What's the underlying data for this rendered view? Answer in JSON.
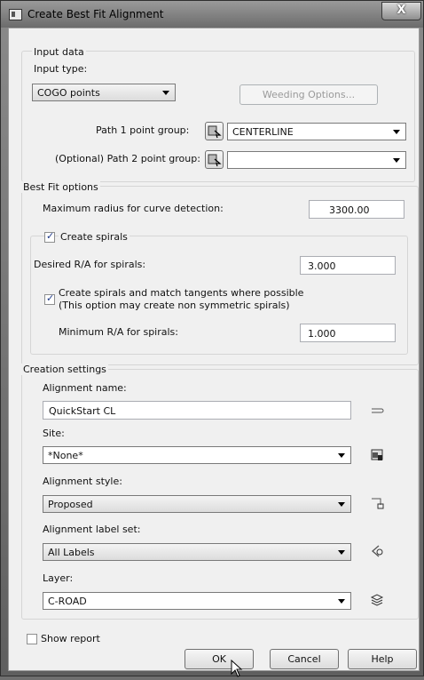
{
  "window": {
    "title": "Create Best Fit Alignment",
    "close": "X"
  },
  "input_data": {
    "group_label": "Input data",
    "input_type_label": "Input type:",
    "input_type_value": "COGO points",
    "weeding_button": "Weeding Options...",
    "path1_label": "Path 1 point group:",
    "path1_value": "CENTERLINE",
    "path2_label": "(Optional) Path 2 point group:",
    "path2_value": ""
  },
  "best_fit": {
    "group_label": "Best Fit options",
    "max_radius_label": "Maximum radius for curve detection:",
    "max_radius_value": "3300.00",
    "create_spirals_label": "Create spirals",
    "create_spirals_checked": true,
    "desired_ra_label": "Desired R/A for spirals:",
    "desired_ra_value": "3.000",
    "match_tangents_label_1": "Create spirals and match tangents where possible",
    "match_tangents_label_2": "(This option may create non symmetric spirals)",
    "match_tangents_checked": true,
    "min_ra_label": "Minimum R/A for spirals:",
    "min_ra_value": "1.000"
  },
  "creation": {
    "group_label": "Creation settings",
    "name_label": "Alignment name:",
    "name_value": "QuickStart CL",
    "site_label": "Site:",
    "site_value": "*None*",
    "style_label": "Alignment style:",
    "style_value": "Proposed",
    "labelset_label": "Alignment label set:",
    "labelset_value": "All Labels",
    "layer_label": "Layer:",
    "layer_value": "C-ROAD"
  },
  "footer": {
    "show_report_label": "Show report",
    "show_report_checked": false,
    "ok": "OK",
    "cancel": "Cancel",
    "help": "Help"
  }
}
